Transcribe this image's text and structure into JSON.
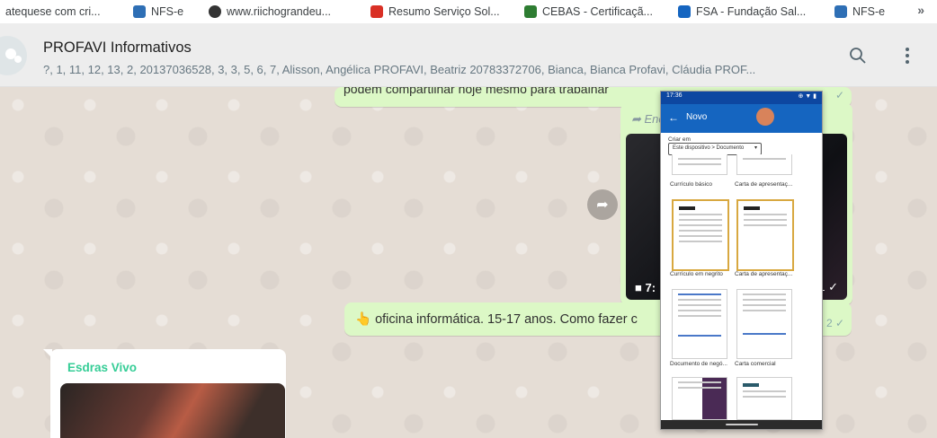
{
  "bookmarks": [
    {
      "label": "atequese com cri...",
      "icon": "brand-icon",
      "color": "#ffffff"
    },
    {
      "label": "NFS-e",
      "icon": "nfse-icon",
      "color": "#2e6fb5"
    },
    {
      "label": "www.riichograndeu...",
      "icon": "globe-icon",
      "color": "#333333"
    },
    {
      "label": "Resumo Serviço Sol...",
      "icon": "doc-icon",
      "color": "#d93025"
    },
    {
      "label": "CEBAS - Certificaçã...",
      "icon": "cebas-icon",
      "color": "#2e7d32"
    },
    {
      "label": "FSA - Fundação Sal...",
      "icon": "fsa-icon",
      "color": "#1565c0"
    },
    {
      "label": "NFS-e",
      "icon": "nfse-icon",
      "color": "#2e6fb5"
    }
  ],
  "bookmarks_overflow": "»",
  "header": {
    "title": "PROFAVI Informativos",
    "participants": "?, 1, 11, 12, 13, 2, 20137036528, 3, 3, 5, 6, 7, Alisson, Angélica PROFAVI, Beatriz 20783372706, Bianca, Bianca Profavi, Cláudia PROF..."
  },
  "messages": {
    "msg1_text": "podem compartilhar hoje mesmo para trabalhar",
    "msg1_ticks": "✓",
    "forwarded_label": "➦ Encaminhada",
    "video_duration": "7:",
    "video_time": "1 ✓",
    "msg3_emoji": "👆",
    "msg3_text": "oficina informática. 15-17 anos. Como fazer c",
    "msg3_time": "2 ✓",
    "sender_name": "Esdras Vivo"
  },
  "phone": {
    "status_time": "17:36",
    "status_icons": "⊕ ▼ ▮",
    "screen_title": "Novo",
    "create_in_label": "Criar em",
    "location_value": "Este dispositivo > Documento",
    "templates": [
      {
        "name": "Currículo básico"
      },
      {
        "name": "Carta de apresentaç..."
      },
      {
        "name": "Currículo em negrito"
      },
      {
        "name": "Carta de apresentaç..."
      },
      {
        "name": "Documento de negó..."
      },
      {
        "name": "Carta comercial"
      },
      {
        "name": ""
      },
      {
        "name": ""
      }
    ]
  },
  "colors": {
    "outgoing_bubble": "#dcf8c6",
    "sender_name": "#35cd96",
    "phone_appbar": "#1565c0"
  }
}
